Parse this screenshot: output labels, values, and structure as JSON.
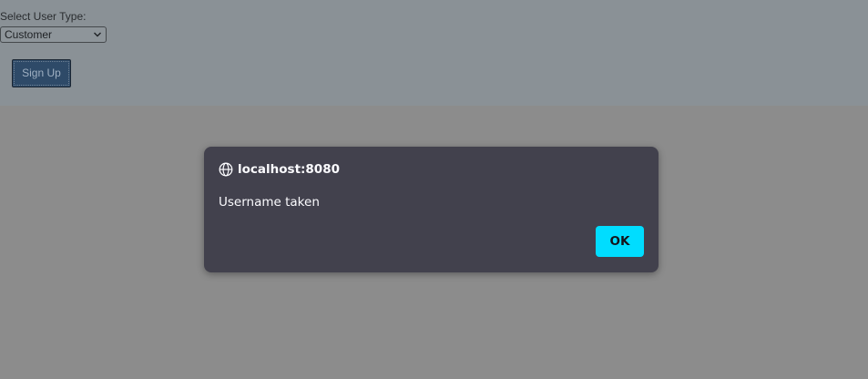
{
  "form": {
    "user_type_label": "Select User Type:",
    "user_type_value": "Customer",
    "signup_label": "Sign Up"
  },
  "dialog": {
    "origin": "localhost:8080",
    "message": "Username taken",
    "ok_label": "OK",
    "icon": "globe-icon"
  },
  "colors": {
    "dialog_bg": "#42414d",
    "ok_button": "#00ddff",
    "signup_button": "#2e4a68"
  }
}
